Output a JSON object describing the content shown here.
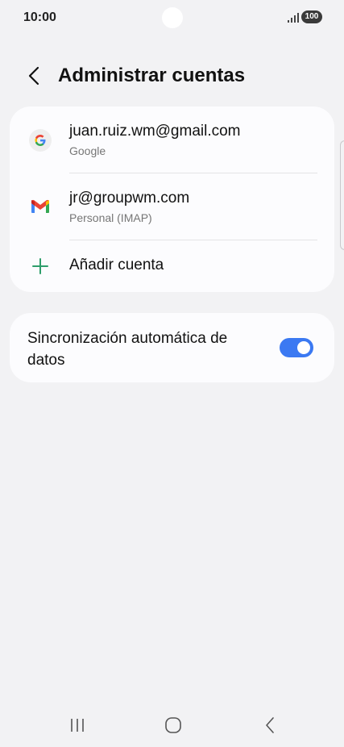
{
  "status_bar": {
    "time": "10:00",
    "battery": "100"
  },
  "header": {
    "title": "Administrar cuentas"
  },
  "accounts": [
    {
      "email": "juan.ruiz.wm@gmail.com",
      "type": "Google",
      "icon": "google-icon"
    },
    {
      "email": "jr@groupwm.com",
      "type": "Personal (IMAP)",
      "icon": "gmail-icon"
    }
  ],
  "add_account": {
    "label": "Añadir cuenta",
    "icon": "plus-icon"
  },
  "sync": {
    "label": "Sincronización automática de datos",
    "enabled": true
  },
  "colors": {
    "accent": "#3b79f2",
    "add_icon": "#2e9e6b",
    "background": "#f2f2f4",
    "card": "#fcfcfe"
  }
}
